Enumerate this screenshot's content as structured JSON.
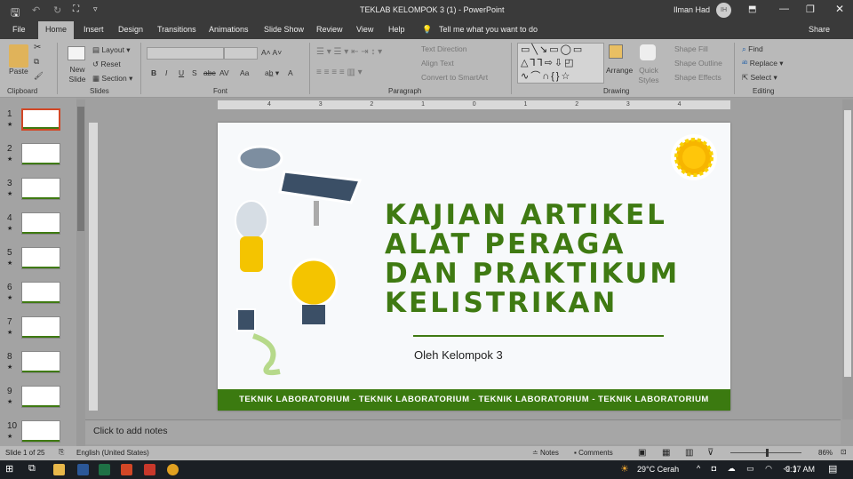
{
  "window": {
    "title": "TEKLAB KELOMPOK 3 (1)  -  PowerPoint",
    "user": "Ilman Had",
    "initials": "IH"
  },
  "tabs": [
    "File",
    "Home",
    "Insert",
    "Design",
    "Transitions",
    "Animations",
    "Slide Show",
    "Review",
    "View",
    "Help"
  ],
  "tell_me": "Tell me what you want to do",
  "share": "Share",
  "ribbon": {
    "clipboard": {
      "label": "Clipboard",
      "paste": "Paste"
    },
    "slides": {
      "label": "Slides",
      "new_slide": "New Slide",
      "layout": "Layout",
      "reset": "Reset",
      "section": "Section"
    },
    "font": {
      "label": "Font",
      "bold": "B",
      "italic": "I",
      "underline": "U",
      "shadow": "S",
      "strike": "abc",
      "spacing": "AV",
      "case": "Aa",
      "color": "A"
    },
    "paragraph": {
      "label": "Paragraph",
      "text_direction": "Text Direction",
      "align_text": "Align Text",
      "convert": "Convert to SmartArt"
    },
    "drawing": {
      "label": "Drawing",
      "arrange": "Arrange",
      "quick_styles": "Quick Styles",
      "shape_fill": "Shape Fill",
      "shape_outline": "Shape Outline",
      "shape_effects": "Shape Effects"
    },
    "editing": {
      "label": "Editing",
      "find": "Find",
      "replace": "Replace",
      "select": "Select"
    }
  },
  "ruler": [
    "4",
    "3",
    "2",
    "1",
    "0",
    "1",
    "2",
    "3",
    "4"
  ],
  "thumbnails": [
    "1",
    "2",
    "3",
    "4",
    "5",
    "6",
    "7",
    "8",
    "9",
    "10"
  ],
  "slide": {
    "title_lines": [
      "KAJIAN ARTIKEL",
      "ALAT PERAGA",
      "DAN PRAKTIKUM",
      "KELISTRIKAN"
    ],
    "subtitle": "Oleh Kelompok 3",
    "footer": "TEKNIK LABORATORIUM  - TEKNIK LABORATORIUM - TEKNIK LABORATORIUM - TEKNIK LABORATORIUM",
    "accent": "#3f7a12"
  },
  "notes_placeholder": "Click to add notes",
  "status": {
    "slide": "Slide 1 of 25",
    "language": "English (United States)",
    "notes": "Notes",
    "comments": "Comments",
    "zoom": "86%"
  },
  "taskbar": {
    "weather": "29°C  Cerah",
    "time": "9:17 AM"
  }
}
